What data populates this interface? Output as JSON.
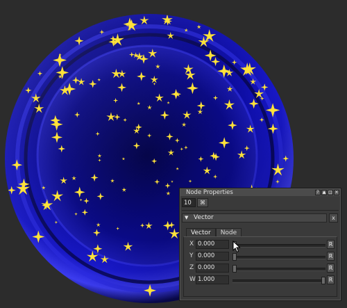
{
  "panel": {
    "title": "Node Properties",
    "title_buttons": [
      "?",
      "▲",
      "□",
      "×"
    ],
    "index_value": "10",
    "pin_glyph": "⌘",
    "section": {
      "arrow": "▼",
      "label": "Vector",
      "close_label": "x"
    },
    "tabs": [
      {
        "label": "Vector",
        "active": true
      },
      {
        "label": "Node",
        "active": false
      }
    ],
    "params": [
      {
        "label": "X",
        "value": "0.000",
        "slider": 0.0,
        "reset": "R"
      },
      {
        "label": "Y",
        "value": "0.000",
        "slider": 0.0,
        "reset": "R"
      },
      {
        "label": "Z",
        "value": "0.000",
        "slider": 0.0,
        "reset": "R"
      },
      {
        "label": "W",
        "value": "1.000",
        "slider": 1.0,
        "reset": "R"
      }
    ]
  },
  "render": {
    "subject": "sphere",
    "base_color": "#0a0a8c",
    "rim_color": "#4a4aff",
    "star_color": "#ffe23a"
  },
  "colors": {
    "background": "#2c2c2c",
    "panel": "#3a3a3a"
  }
}
